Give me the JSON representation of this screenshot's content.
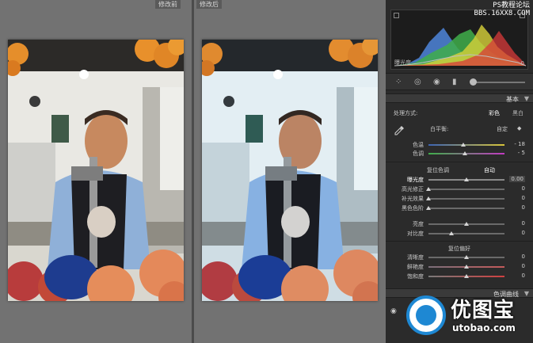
{
  "compare": {
    "before_label": "修改前",
    "after_label": "修改后"
  },
  "watermark_top": {
    "line1": "PS教程论坛",
    "line2": "BBS.16XX8.COM"
  },
  "histogram": {
    "label": "曝光度",
    "value": "0"
  },
  "basic": {
    "section_title": "基本",
    "treatment_label": "处理方式:",
    "treatment_color": "彩色",
    "treatment_bw": "黑白",
    "wb_label": "白平衡:",
    "wb_value": "自定",
    "temp_label": "色温",
    "temp_value": "- 18",
    "temp_pos": 0.46,
    "tint_label": "色调",
    "tint_value": "- 5",
    "tint_pos": 0.48,
    "tone_title": "复位色调",
    "auto_label": "自动",
    "exposure_label": "曝光度",
    "exposure_value": "0.00",
    "exposure_pos": 0.5,
    "recovery_label": "高光修正",
    "recovery_value": "0",
    "recovery_pos": 0.0,
    "fill_label": "补光效果",
    "fill_value": "0",
    "fill_pos": 0.0,
    "blacks_label": "黑色色阶",
    "blacks_value": "0",
    "blacks_pos": 0.0,
    "brightness_label": "亮度",
    "brightness_value": "0",
    "brightness_pos": 0.5,
    "contrast_label": "对比度",
    "contrast_value": "0",
    "contrast_pos": 0.3,
    "presence_title": "复位偏好",
    "clarity_label": "清晰度",
    "clarity_value": "0",
    "clarity_pos": 0.5,
    "vibrance_label": "鲜艳度",
    "vibrance_value": "0",
    "vibrance_pos": 0.5,
    "saturation_label": "饱和度",
    "saturation_value": "0",
    "saturation_pos": 0.5
  },
  "curves": {
    "section_title": "色调曲线"
  },
  "watermark_bottom": {
    "brand_cn": "优图宝",
    "brand_en": "utobao.com"
  },
  "colors": {
    "accent_blue": "#1e88d3",
    "panel_bg": "#2b2b2b"
  }
}
